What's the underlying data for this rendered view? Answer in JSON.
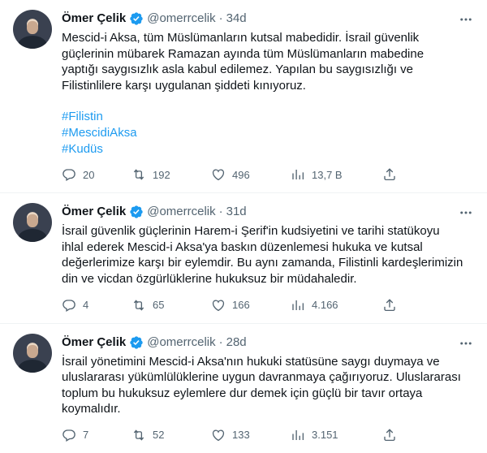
{
  "tweets": [
    {
      "name": "Ömer Çelik",
      "handle": "@omerrcelik",
      "dot": "·",
      "time": "34d",
      "text": "Mescid-i Aksa, tüm Müslümanların kutsal mabedidir. İsrail güvenlik\ngüçlerinin mübarek Ramazan ayında tüm Müslümanların mabedine\nyaptığı saygısızlık asla kabul edilemez. Yapılan bu saygısızlığı ve\nFilistinlilere karşı uygulanan şiddeti kınıyoruz.",
      "hashtags": [
        "#Filistin",
        "#MescidiAksa",
        "#Kudüs"
      ],
      "replies": "20",
      "retweets": "192",
      "likes": "496",
      "views": "13,7 B"
    },
    {
      "name": "Ömer Çelik",
      "handle": "@omerrcelik",
      "dot": "·",
      "time": "31d",
      "text": "İsrail güvenlik güçlerinin Harem-i Şerif'in kudsiyetini ve tarihi statükoyu\nihlal ederek Mescid-i Aksa'ya baskın düzenlemesi hukuka ve kutsal\ndeğerlerimize karşı bir eylemdir. Bu aynı zamanda, Filistinli kardeşlerimizin\ndin ve vicdan özgürlüklerine hukuksuz bir müdahaledir.",
      "hashtags": [],
      "replies": "4",
      "retweets": "65",
      "likes": "166",
      "views": "4.166"
    },
    {
      "name": "Ömer Çelik",
      "handle": "@omerrcelik",
      "dot": "·",
      "time": "28d",
      "text": "İsrail yönetimini Mescid-i Aksa'nın hukuki statüsüne saygı duymaya ve\nuluslararası yükümlülüklerine uygun davranmaya çağırıyoruz. Uluslararası\ntoplum bu hukuksuz eylemlere dur demek için güçlü bir tavır ortaya\nkoymalıdır.",
      "hashtags": [],
      "replies": "7",
      "retweets": "52",
      "likes": "133",
      "views": "3.151"
    }
  ],
  "icons": {
    "verified": "verified-badge-icon",
    "more": "more-icon",
    "reply": "reply-icon",
    "retweet": "retweet-icon",
    "like": "heart-icon",
    "views": "views-icon",
    "share": "share-icon"
  },
  "colors": {
    "accent": "#1d9bf0",
    "text": "#0f1419",
    "secondary": "#536471",
    "divider": "#eff3f4"
  }
}
